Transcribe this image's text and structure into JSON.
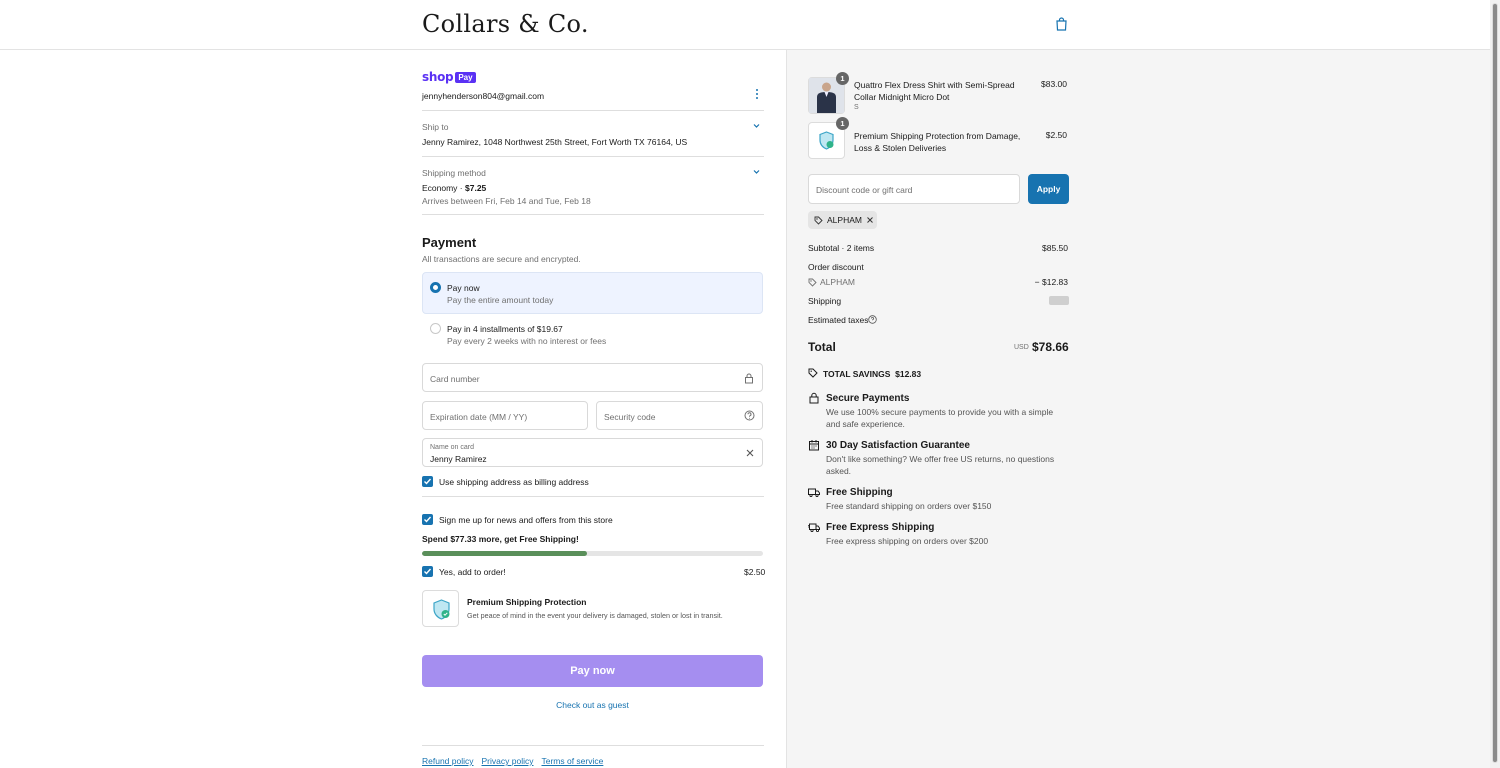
{
  "store": {
    "name": "Collars & Co."
  },
  "shop_pay": {
    "word": "shop",
    "badge": "Pay"
  },
  "contact": {
    "email": "jennyhenderson804@gmail.com"
  },
  "ship_to": {
    "label": "Ship to",
    "value": "Jenny Ramirez, 1048 Northwest 25th Street, Fort Worth TX 76164, US"
  },
  "shipping_method": {
    "label": "Shipping method",
    "name": "Economy · ",
    "price": "$7.25",
    "eta": "Arrives between Fri, Feb 14 and Tue, Feb 18"
  },
  "payment": {
    "title": "Payment",
    "subtitle": "All transactions are secure and encrypted.",
    "options": [
      {
        "label": "Pay now",
        "desc": "Pay the entire amount today",
        "selected": true
      },
      {
        "label": "Pay in 4 installments of $19.67",
        "desc": "Pay every 2 weeks with no interest or fees",
        "selected": false
      }
    ],
    "card_number_placeholder": "Card number",
    "expiration_placeholder": "Expiration date (MM / YY)",
    "security_placeholder": "Security code",
    "name_label": "Name on card",
    "name_value": "Jenny Ramirez",
    "billing_checkbox": "Use shipping address as billing address"
  },
  "marketing": {
    "newsletter": "Sign me up for news and offers from this store",
    "free_shipping_msg": "Spend $77.33 more, get Free Shipping!",
    "progress": 0.485,
    "add_label": "Yes, add to order!",
    "add_price": "$2.50",
    "protection_title": "Premium Shipping Protection",
    "protection_desc": "Get peace of mind in the event your delivery is damaged, stolen or lost in transit."
  },
  "actions": {
    "pay_now": "Pay now",
    "guest": "Check out as guest"
  },
  "footer": {
    "links": [
      "Refund policy",
      "Privacy policy",
      "Terms of service"
    ]
  },
  "cart": {
    "items": [
      {
        "name": "Quattro Flex Dress Shirt with Semi-Spread Collar Midnight Micro Dot",
        "variant": "S",
        "qty": "1",
        "price": "$83.00"
      },
      {
        "name": "Premium Shipping Protection from Damage, Loss & Stolen Deliveries",
        "variant": "",
        "qty": "1",
        "price": "$2.50"
      }
    ],
    "discount_placeholder": "Discount code or gift card",
    "apply_label": "Apply",
    "applied_code": "ALPHAM",
    "subtotal_label": "Subtotal · 2 items",
    "subtotal_value": "$85.50",
    "order_discount_label": "Order discount",
    "discount_code": "ALPHAM",
    "discount_value": "− $12.83",
    "shipping_label": "Shipping",
    "taxes_label": "Estimated taxes",
    "total_label": "Total",
    "currency": "USD",
    "total_value": "$78.66",
    "savings_label": "TOTAL SAVINGS",
    "savings_value": "$12.83"
  },
  "features": [
    {
      "icon": "lock-icon",
      "title": "Secure Payments",
      "desc": "We use 100% secure payments to provide you with a simple and safe experience."
    },
    {
      "icon": "calendar-icon",
      "title": "30 Day Satisfaction Guarantee",
      "desc": "Don't like something? We offer free US returns, no questions asked."
    },
    {
      "icon": "truck-icon",
      "title": "Free Shipping",
      "desc": "Free standard shipping on orders over $150"
    },
    {
      "icon": "express-truck-icon",
      "title": "Free Express Shipping",
      "desc": "Free express shipping on orders over $200"
    }
  ],
  "colors": {
    "accent": "#1773b0",
    "shop_pay": "#5a31f4",
    "pay_button": "#a58ef0",
    "progress": "#5a8f5a"
  }
}
